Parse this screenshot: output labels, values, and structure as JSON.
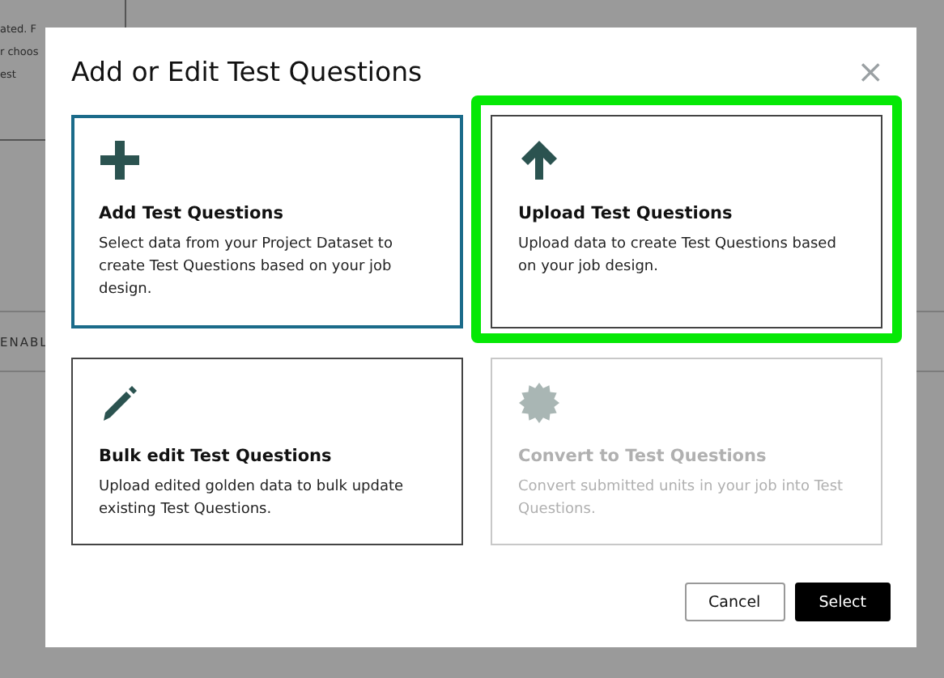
{
  "background": {
    "lines": [
      "ated. F",
      "r choos",
      "est"
    ],
    "row_label": "ENABL"
  },
  "dialog": {
    "title": "Add or Edit Test Questions",
    "close": "×",
    "options": [
      {
        "kind": "add",
        "title": "Add Test Questions",
        "description": "Select data from your Project Dataset to create Test Questions based on your job design.",
        "selected": true,
        "highlighted": false,
        "disabled": false
      },
      {
        "kind": "upload",
        "title": "Upload Test Questions",
        "description": "Upload data to create Test Questions based on your job design.",
        "selected": false,
        "highlighted": true,
        "disabled": false
      },
      {
        "kind": "edit",
        "title": "Bulk edit Test Questions",
        "description": "Upload edited golden data to bulk update existing Test Questions.",
        "selected": false,
        "highlighted": false,
        "disabled": false
      },
      {
        "kind": "convert",
        "title": "Convert to Test Questions",
        "description": "Convert submitted units in your job into Test Questions.",
        "selected": false,
        "highlighted": false,
        "disabled": true
      }
    ],
    "buttons": [
      {
        "label": "Cancel",
        "kind": "secondary"
      },
      {
        "label": "Select",
        "kind": "primary"
      }
    ]
  }
}
